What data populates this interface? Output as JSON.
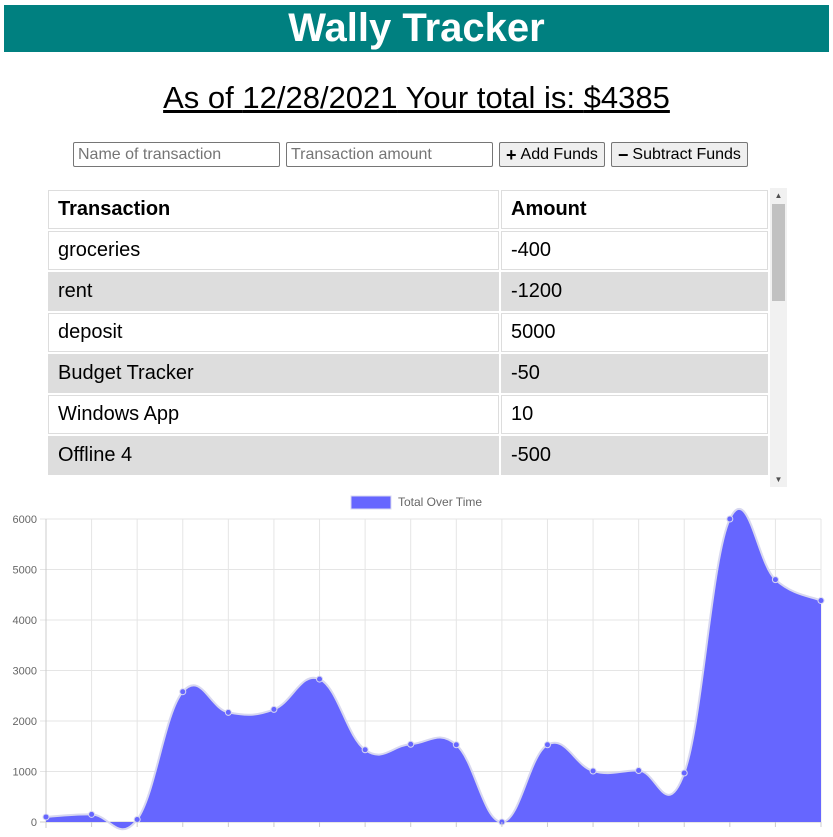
{
  "header": {
    "title": "Wally Tracker"
  },
  "summary": {
    "prefix": "As of ",
    "date": "12/28/2021",
    "middle": " Your total is: ",
    "total": "$4385"
  },
  "form": {
    "name_placeholder": "Name of transaction",
    "amount_placeholder": "Transaction amount",
    "add_label": "Add Funds",
    "subtract_label": "Subtract Funds"
  },
  "table": {
    "headers": [
      "Transaction",
      "Amount"
    ],
    "rows": [
      [
        "groceries",
        "-400"
      ],
      [
        "rent",
        "-1200"
      ],
      [
        "deposit",
        "5000"
      ],
      [
        "Budget Tracker",
        "-50"
      ],
      [
        "Windows App",
        "10"
      ],
      [
        "Offline 4",
        "-500"
      ]
    ]
  },
  "chart_data": {
    "type": "area",
    "series": [
      {
        "name": "Total Over Time",
        "color": "#6666ff",
        "values": [
          100,
          150,
          50,
          2580,
          2170,
          2230,
          2830,
          1430,
          1540,
          1530,
          0,
          1530,
          1010,
          1020,
          970,
          6000,
          4800,
          4385
        ]
      }
    ],
    "ylim": [
      0,
      6000
    ],
    "yticks": [
      0,
      1000,
      2000,
      3000,
      4000,
      5000,
      6000
    ],
    "legend": "top",
    "grid": true
  }
}
